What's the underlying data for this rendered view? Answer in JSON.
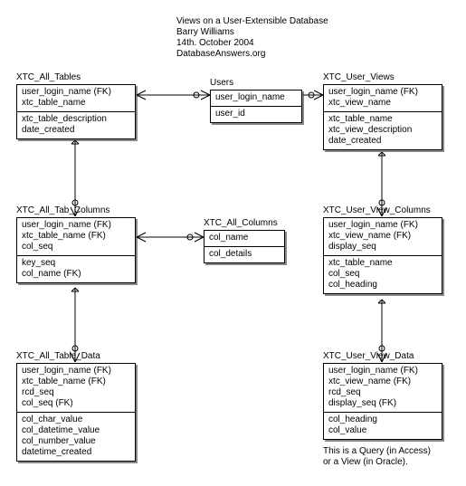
{
  "header": {
    "title": "Views on a User-Extensible Database",
    "author": "Barry Williams",
    "date": "14th. October 2004",
    "site": "DatabaseAnswers.org"
  },
  "entities": {
    "users": {
      "title": "Users",
      "r1c1": "user_login_name",
      "r2c1": "user_id"
    },
    "all_tables": {
      "title": "XTC_All_Tables",
      "r1c1": "user_login_name (FK)",
      "r1c2": "xtc_table_name",
      "r2c1": "xtc_table_description",
      "r2c2": "date_created"
    },
    "user_views": {
      "title": "XTC_User_Views",
      "r1c1": "user_login_name (FK)",
      "r1c2": "xtc_view_name",
      "r2c1": "xtc_table_name",
      "r2c2": "xtc_view_description",
      "r2c3": "date_created"
    },
    "all_tab_columns": {
      "title": "XTC_All_Tab_Columns",
      "r1c1": "user_login_name (FK)",
      "r1c2": "xtc_table_name (FK)",
      "r1c3": "col_seq",
      "r2c1": "key_seq",
      "r2c2": "col_name (FK)"
    },
    "all_columns": {
      "title": "XTC_All_Columns",
      "r1c1": "col_name",
      "r2c1": "col_details"
    },
    "user_view_columns": {
      "title": "XTC_User_View_Columns",
      "r1c1": "user_login_name (FK)",
      "r1c2": "xtc_view_name (FK)",
      "r1c3": "display_seq",
      "r2c1": "xtc_table_name",
      "r2c2": "col_seq",
      "r2c3": "col_heading"
    },
    "all_table_data": {
      "title": "XTC_All_Table_Data",
      "r1c1": "user_login_name (FK)",
      "r1c2": "xtc_table_name (FK)",
      "r1c3": "rcd_seq",
      "r1c4": "col_seq (FK)",
      "r2c1": "col_char_value",
      "r2c2": "col_datetime_value",
      "r2c3": "col_number_value",
      "r2c4": "datetime_created"
    },
    "user_view_data": {
      "title": "XTC_User_View_Data",
      "r1c1": "user_login_name (FK)",
      "r1c2": "xtc_view_name (FK)",
      "r1c3": "rcd_seq",
      "r1c4": "display_seq (FK)",
      "r2c1": "col_heading",
      "r2c2": "col_value"
    }
  },
  "note": {
    "line1": "This is a Query (in Access)",
    "line2": "or a View (in Oracle)."
  }
}
